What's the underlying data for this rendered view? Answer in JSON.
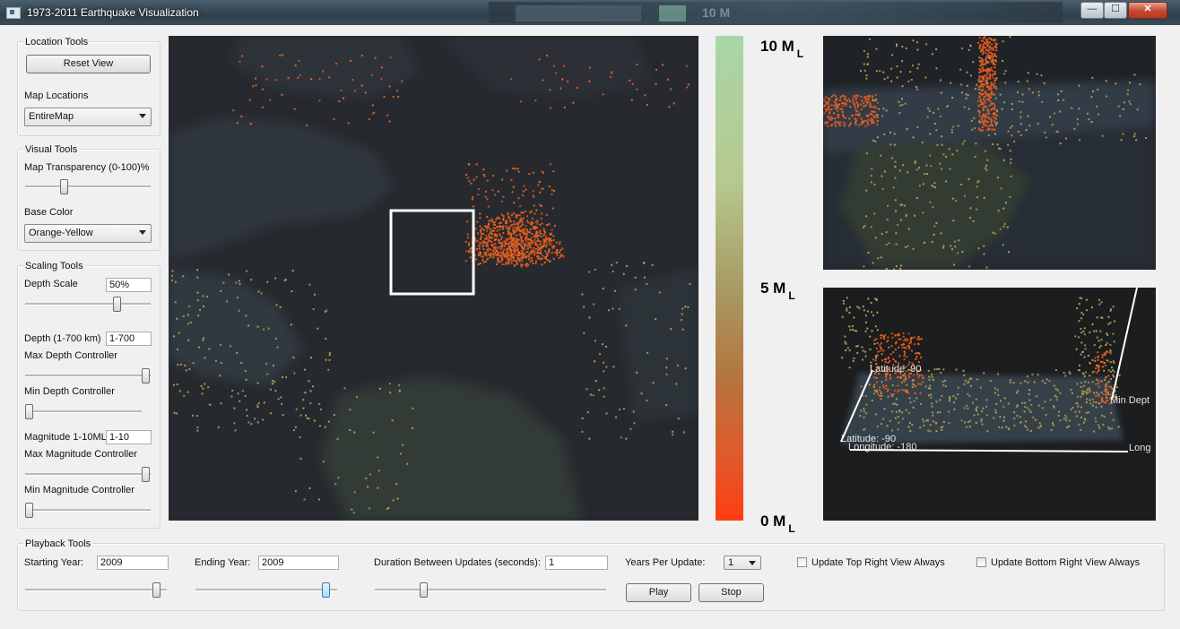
{
  "window": {
    "title": "1973-2011 Earthquake Visualization",
    "min": "—",
    "max": "☐",
    "close": "✕"
  },
  "location_tools": {
    "title": "Location Tools",
    "reset_label": "Reset View",
    "map_locations_label": "Map Locations",
    "map_locations_value": "EntireMap"
  },
  "visual_tools": {
    "title": "Visual Tools",
    "transparency_label": "Map Transparency (0-100)%",
    "transparency_level": 0.3,
    "base_color_label": "Base Color",
    "base_color_value": "Orange-Yellow"
  },
  "scaling_tools": {
    "title": "Scaling Tools",
    "depth_scale_label": "Depth Scale",
    "depth_scale_value": "50%",
    "depth_scale_level": 0.74,
    "depth_range_label": "Depth (1-700 km)",
    "depth_range_value": "1-700",
    "max_depth_label": "Max Depth Controller",
    "max_depth_level": 1.0,
    "min_depth_label": "Min Depth Controller",
    "min_depth_level": 0.0,
    "magnitude_label": "Magnitude 1-10ML",
    "magnitude_value": "1-10",
    "max_mag_label": "Max Magnitude Controller",
    "max_mag_level": 1.0,
    "min_mag_label": "Min Magnitude Controller",
    "min_mag_level": 0.0
  },
  "playback": {
    "title": "Playback Tools",
    "start_label": "Starting Year:",
    "start_value": "2009",
    "start_level": 0.94,
    "end_label": "Ending Year:",
    "end_value": "2009",
    "end_level": 0.97,
    "duration_label": "Duration Between Updates (seconds):",
    "duration_value": "1",
    "duration_level": 0.2,
    "years_label": "Years Per Update:",
    "years_value": "1",
    "play_label": "Play",
    "stop_label": "Stop",
    "update_top_label": "Update Top Right View Always",
    "update_bottom_label": "Update Bottom Right View Always"
  },
  "colorbar": {
    "top_label": "10 M",
    "mid_label": "5 M",
    "bottom_label": "0 M",
    "unit_sub": "L",
    "colors": [
      "#a9d6a6",
      "#a89a63",
      "#ff3d10"
    ]
  },
  "bottom_view_axes": {
    "lat_top": "Latitude: 90",
    "lat_bottom": "Latitude: -90",
    "lon_left": "Longitude: -180",
    "lon_right": "Long",
    "depth": "Min Dept"
  }
}
